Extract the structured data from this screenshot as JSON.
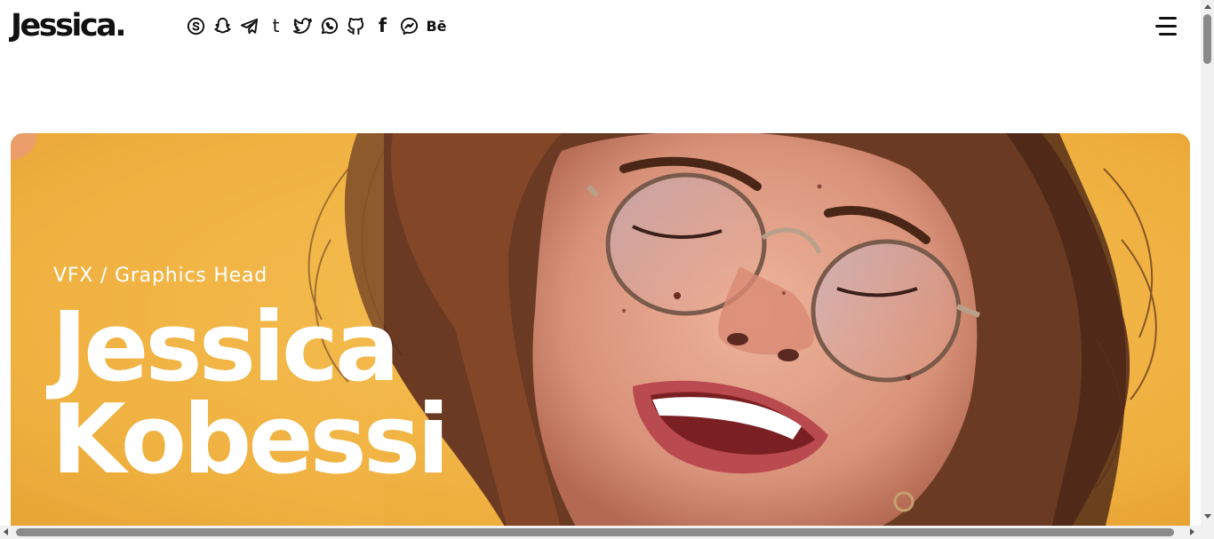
{
  "header": {
    "logo": "Jessica.",
    "social_icons": [
      "skype-icon",
      "snapchat-icon",
      "telegram-icon",
      "tumblr-icon",
      "twitter-icon",
      "whatsapp-icon",
      "github-icon",
      "facebook-icon",
      "messenger-icon",
      "behance-icon"
    ],
    "behance_label": "Bē",
    "facebook_label": "f",
    "tumblr_label": "t",
    "menu_icon": "hamburger-menu-icon"
  },
  "hero": {
    "subtitle": "VFX / Graphics Head",
    "first_name": "Jessica",
    "last_name": "Kobessi",
    "background_color": "#f1b547"
  }
}
